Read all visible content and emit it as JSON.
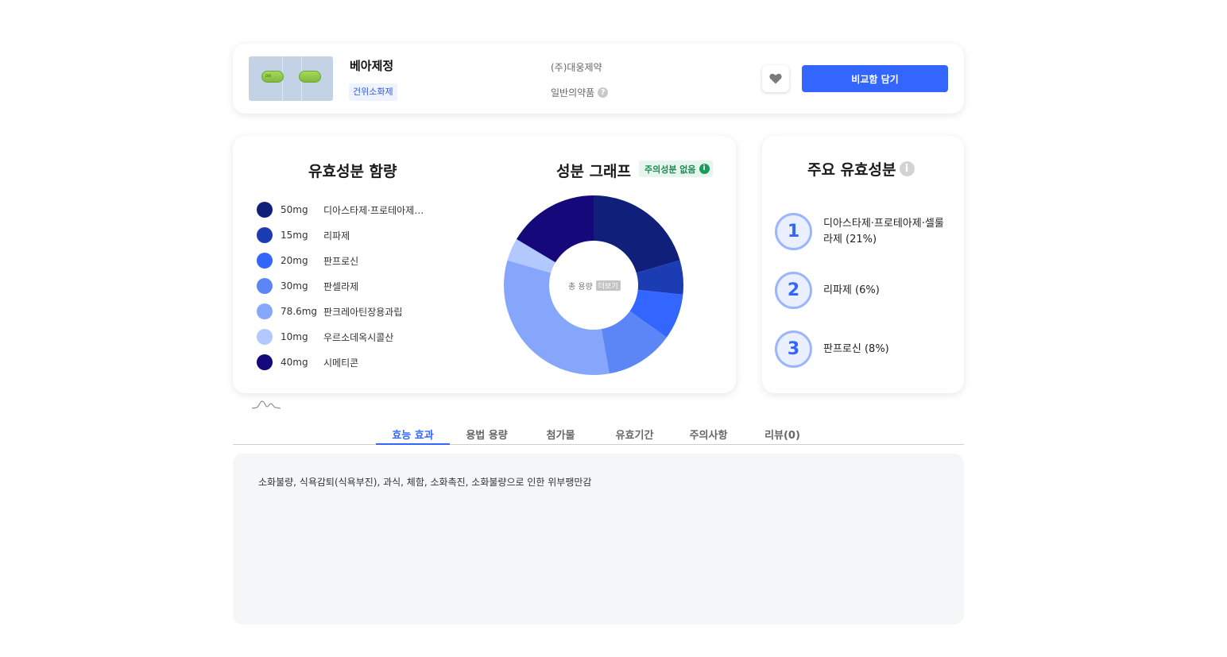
{
  "product": {
    "name": "베아제정",
    "category_tag": "건위소화제",
    "manufacturer": "(주)대웅제약",
    "drug_type": "일반의약품",
    "help_mark": "?",
    "compare_button": "비교함 담기",
    "pill_imprint": "DW"
  },
  "ingredients": {
    "title": "유효성분 함량",
    "items": [
      {
        "amount": "50mg",
        "name": "디아스타제·프로테아제·셀룰라제",
        "color": "#0f1f7a"
      },
      {
        "amount": "15mg",
        "name": "리파제",
        "color": "#1c3cb4"
      },
      {
        "amount": "20mg",
        "name": "판프로신",
        "color": "#3366ff"
      },
      {
        "amount": "30mg",
        "name": "판셀라제",
        "color": "#5c86f6"
      },
      {
        "amount": "78.6mg",
        "name": "판크레아틴장용과립",
        "color": "#86a6fb"
      },
      {
        "amount": "10mg",
        "name": "우르소데옥시콜산",
        "color": "#b2c8ff"
      },
      {
        "amount": "40mg",
        "name": "시메티콘",
        "color": "#14087a"
      }
    ]
  },
  "chart_data": {
    "type": "pie",
    "title": "성분 그래프",
    "categories": [
      "디아스타제·프로테아제·셀룰라제",
      "리파제",
      "판프로신",
      "판셀라제",
      "판크레아틴장용과립",
      "우르소데옥시콜산",
      "시메티콘"
    ],
    "values": [
      50,
      15,
      20,
      30,
      78.6,
      10,
      40
    ],
    "colors": [
      "#0f1f7a",
      "#1c3cb4",
      "#3366ff",
      "#5c86f6",
      "#86a6fb",
      "#b2c8ff",
      "#14087a"
    ],
    "donut": true,
    "center_label": "총 용량",
    "center_button": "더보기"
  },
  "graph": {
    "title": "성분 그래프",
    "warning_badge": "주의성분 없음",
    "info_mark": "i"
  },
  "main_ingredients": {
    "title": "주요 유효성분",
    "info_mark": "i",
    "items": [
      {
        "rank": "1",
        "text": "디아스타제·프로테아제·셀룰라제 (21%)"
      },
      {
        "rank": "2",
        "text": "리파제 (6%)"
      },
      {
        "rank": "3",
        "text": "판프로신 (8%)"
      }
    ]
  },
  "tabs": [
    {
      "label": "효능 효과",
      "active": true
    },
    {
      "label": "용법 용량",
      "active": false
    },
    {
      "label": "첨가물",
      "active": false
    },
    {
      "label": "유효기간",
      "active": false
    },
    {
      "label": "주의사항",
      "active": false
    },
    {
      "label": "리뷰(0)",
      "active": false
    }
  ],
  "content": {
    "efficacy_text": "소화불량, 식욕감퇴(식욕부진), 과식, 체함, 소화촉진, 소화불량으로 인한 위부팽만감"
  },
  "icons": {
    "heart": "heart-icon",
    "wave": "wave-icon",
    "info": "info-icon",
    "help": "question-icon"
  },
  "colors": {
    "accent": "#3366ff",
    "badge_green": "#1c8a52"
  }
}
